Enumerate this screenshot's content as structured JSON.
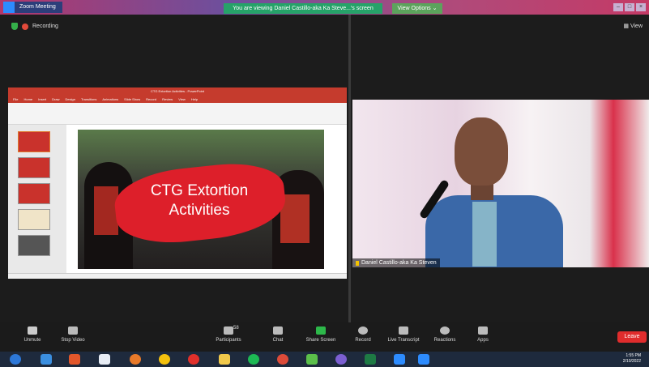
{
  "window": {
    "title": "Zoom Meeting"
  },
  "banner": {
    "viewing_text": "You are viewing Daniel Castillo-aka Ka Steve...'s screen",
    "view_options": "View Options ⌄"
  },
  "meeting": {
    "recording_label": "Recording",
    "view_label": "View"
  },
  "shared_screen": {
    "ppt_title": "CTG Extortion Activities - PowerPoint",
    "ribbon_tabs": [
      "File",
      "Home",
      "Insert",
      "Draw",
      "Design",
      "Transitions",
      "Animations",
      "Slide Show",
      "Record",
      "Review",
      "View",
      "Help"
    ],
    "slide_text_line1": "CTG Extortion",
    "slide_text_line2": "Activities"
  },
  "speaker": {
    "name": "Daniel Castillo-aka Ka Steven"
  },
  "toolbar": {
    "unmute": "Unmute",
    "stop_video": "Stop Video",
    "participants": "Participants",
    "participants_count": "58",
    "chat": "Chat",
    "share_screen": "Share Screen",
    "record": "Record",
    "live_transcript": "Live Transcript",
    "reactions": "Reactions",
    "apps": "Apps",
    "leave": "Leave"
  },
  "taskbar": {
    "time": "1:55 PM",
    "date": "2/10/2022"
  },
  "colors": {
    "zoom_blue": "#2d8cff",
    "leave_red": "#e02c2c",
    "share_green": "#2db84a",
    "ppt_red": "#c53b2d"
  }
}
